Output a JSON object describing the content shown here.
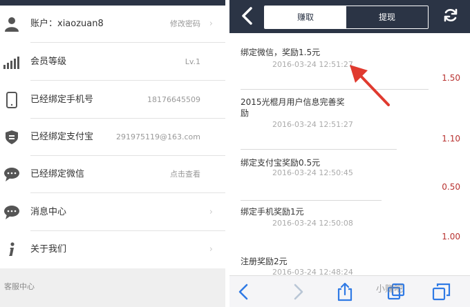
{
  "left": {
    "rows": [
      {
        "label": "账户：xiaozuan8",
        "value": "修改密码",
        "chevron": "›",
        "icon": "user-icon"
      },
      {
        "label": "会员等级",
        "value": "Lv.1",
        "chevron": "",
        "icon": "signal-bars-icon"
      },
      {
        "label": "已经绑定手机号",
        "value": "18176645509",
        "chevron": "",
        "icon": "phone-icon"
      },
      {
        "label": "已经绑定支付宝",
        "value": "291975119@163.com",
        "chevron": "",
        "icon": "alipay-shield-icon"
      },
      {
        "label": "已经绑定微信",
        "value": "点击查看",
        "chevron": "",
        "icon": "chat-bubble-icon"
      },
      {
        "label": "消息中心",
        "value": "",
        "chevron": "›",
        "icon": "message-icon"
      },
      {
        "label": "关于我们",
        "value": "",
        "chevron": "›",
        "icon": "info-icon"
      }
    ],
    "footer": "客服中心"
  },
  "right": {
    "tabs": {
      "active": "赚取",
      "inactive": "提现"
    },
    "entries": [
      {
        "title": "绑定微信，奖励1.5元",
        "date": "2016-03-24 12:51:27",
        "amount": "1.50"
      },
      {
        "title": "2015光棍月用户信息完善奖励",
        "date": "2016-03-24 12:51:27",
        "amount": "1.10"
      },
      {
        "title": "绑定支付宝奖励0.5元",
        "date": "2016-03-24 12:50:45",
        "amount": "0.50"
      },
      {
        "title": "绑定手机奖励1元",
        "date": "2016-03-24 12:50:08",
        "amount": "1.00"
      },
      {
        "title": "注册奖励2元",
        "date": "2016-03-24 12:48:24",
        "amount": ""
      }
    ],
    "watermark": "小赚吧"
  },
  "colors": {
    "nav_bg": "#2b3445",
    "amount": "#b8312f",
    "arrow": "#e03a2f",
    "toolbar_icon": "#2f7ae5"
  }
}
